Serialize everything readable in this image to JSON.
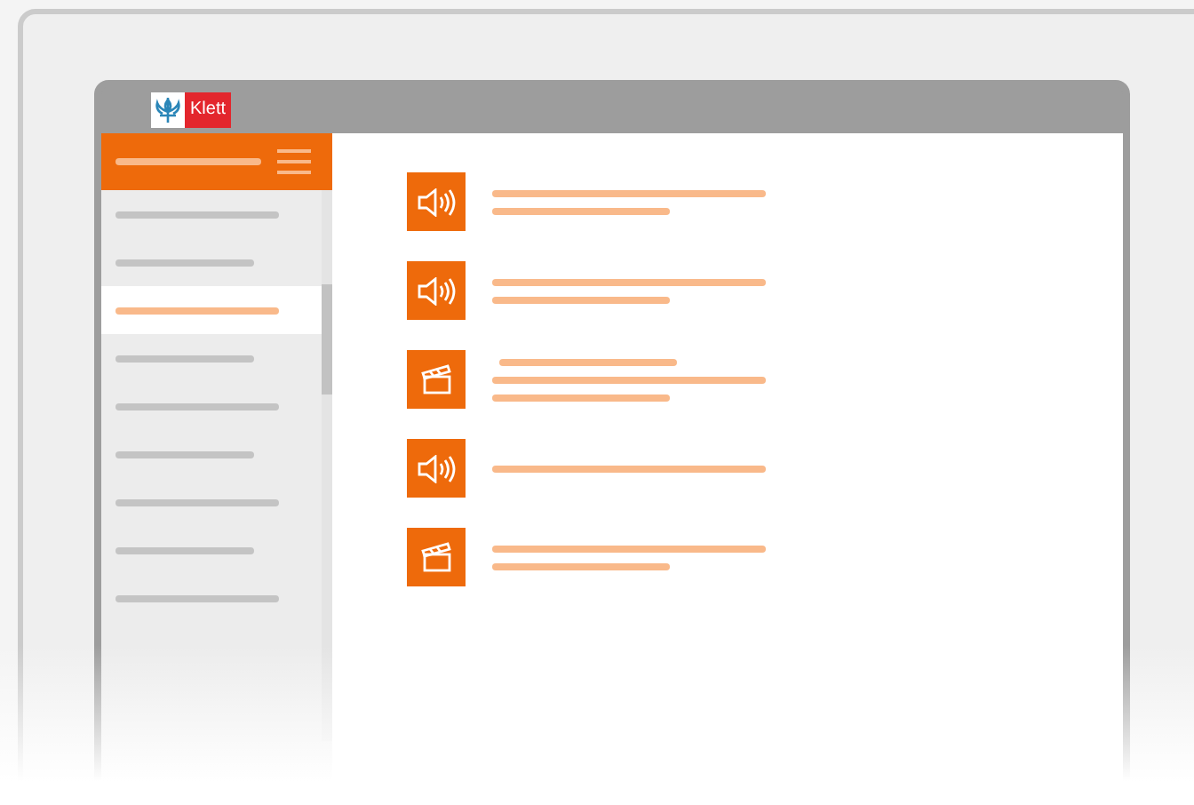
{
  "logo": {
    "text": "Klett"
  },
  "sidebar": {
    "items": [
      {
        "selected": false
      },
      {
        "selected": false
      },
      {
        "selected": true
      },
      {
        "selected": false
      },
      {
        "selected": false
      },
      {
        "selected": false
      },
      {
        "selected": false
      },
      {
        "selected": false
      },
      {
        "selected": false
      }
    ]
  },
  "media": [
    {
      "kind": "audio",
      "caption": false,
      "subtitle": true
    },
    {
      "kind": "audio",
      "caption": false,
      "subtitle": true
    },
    {
      "kind": "video",
      "caption": true,
      "subtitle": true
    },
    {
      "kind": "audio",
      "caption": false,
      "subtitle": false
    },
    {
      "kind": "video",
      "caption": false,
      "subtitle": true
    }
  ]
}
